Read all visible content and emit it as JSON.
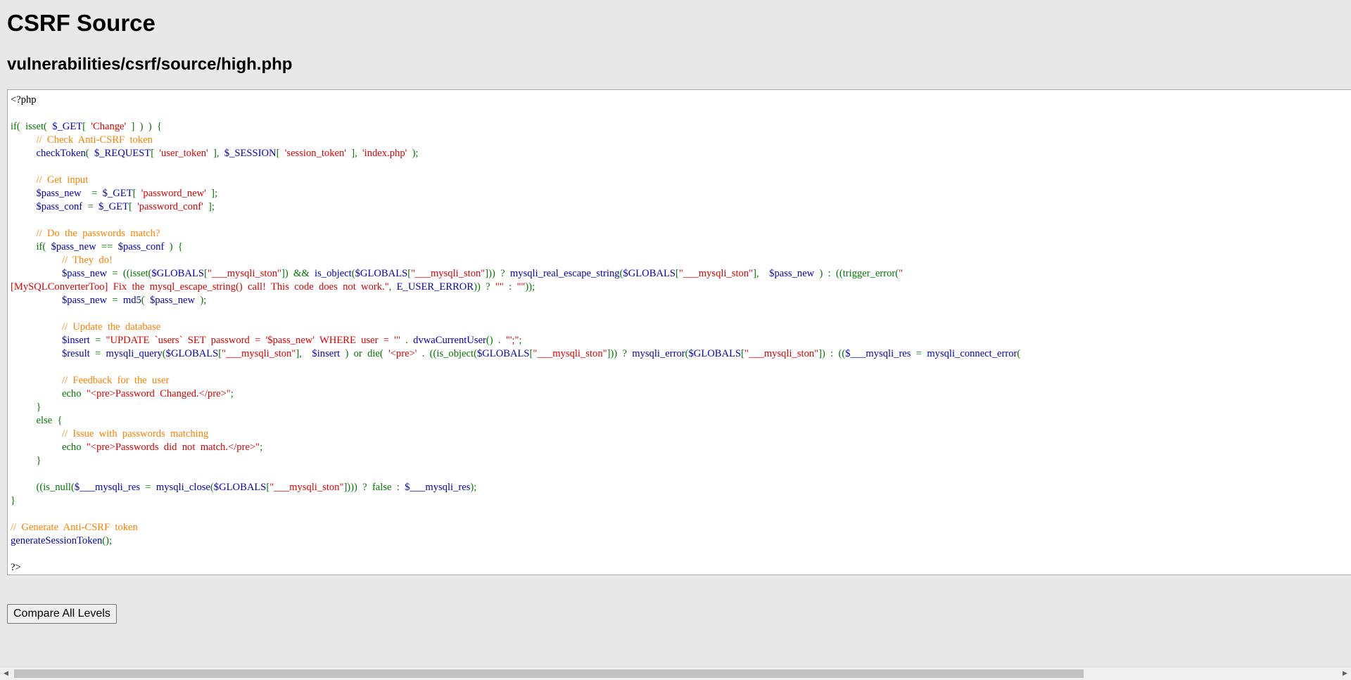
{
  "page": {
    "title": "CSRF Source",
    "path": "vulnerabilities/csrf/source/high.php"
  },
  "code_lines": [
    [
      {
        "c": "def",
        "t": "<?php"
      }
    ],
    [],
    [
      {
        "c": "kw",
        "t": "if(  isset(  "
      },
      {
        "c": "var",
        "t": "$_GET"
      },
      {
        "c": "kw",
        "t": "[  "
      },
      {
        "c": "str",
        "t": "'Change'"
      },
      {
        "c": "kw",
        "t": "  ]  )  )  {"
      }
    ],
    [
      {
        "c": "cmt",
        "t": "          //  Check  Anti-CSRF  token"
      }
    ],
    [
      {
        "c": "kw",
        "t": "          "
      },
      {
        "c": "var",
        "t": "checkToken"
      },
      {
        "c": "kw",
        "t": "(  "
      },
      {
        "c": "var",
        "t": "$_REQUEST"
      },
      {
        "c": "kw",
        "t": "[  "
      },
      {
        "c": "str",
        "t": "'user_token'"
      },
      {
        "c": "kw",
        "t": "  ],  "
      },
      {
        "c": "var",
        "t": "$_SESSION"
      },
      {
        "c": "kw",
        "t": "[  "
      },
      {
        "c": "str",
        "t": "'session_token'"
      },
      {
        "c": "kw",
        "t": "  ],  "
      },
      {
        "c": "str",
        "t": "'index.php'"
      },
      {
        "c": "kw",
        "t": "  );"
      }
    ],
    [],
    [
      {
        "c": "cmt",
        "t": "          //  Get  input"
      }
    ],
    [
      {
        "c": "kw",
        "t": "          "
      },
      {
        "c": "var",
        "t": "$pass_new"
      },
      {
        "c": "kw",
        "t": "    =  "
      },
      {
        "c": "var",
        "t": "$_GET"
      },
      {
        "c": "kw",
        "t": "[  "
      },
      {
        "c": "str",
        "t": "'password_new'"
      },
      {
        "c": "kw",
        "t": "  ];"
      }
    ],
    [
      {
        "c": "kw",
        "t": "          "
      },
      {
        "c": "var",
        "t": "$pass_conf"
      },
      {
        "c": "kw",
        "t": "  =  "
      },
      {
        "c": "var",
        "t": "$_GET"
      },
      {
        "c": "kw",
        "t": "[  "
      },
      {
        "c": "str",
        "t": "'password_conf'"
      },
      {
        "c": "kw",
        "t": "  ];"
      }
    ],
    [],
    [
      {
        "c": "cmt",
        "t": "          //  Do  the  passwords  match?"
      }
    ],
    [
      {
        "c": "kw",
        "t": "          if(  "
      },
      {
        "c": "var",
        "t": "$pass_new"
      },
      {
        "c": "kw",
        "t": "  ==  "
      },
      {
        "c": "var",
        "t": "$pass_conf"
      },
      {
        "c": "kw",
        "t": "  )  {"
      }
    ],
    [
      {
        "c": "cmt",
        "t": "                    //  They  do!"
      }
    ],
    [
      {
        "c": "kw",
        "t": "                    "
      },
      {
        "c": "var",
        "t": "$pass_new"
      },
      {
        "c": "kw",
        "t": "  =  ((isset("
      },
      {
        "c": "var",
        "t": "$GLOBALS"
      },
      {
        "c": "kw",
        "t": "["
      },
      {
        "c": "str",
        "t": "\"___mysqli_ston\""
      },
      {
        "c": "kw",
        "t": "])  &&  "
      },
      {
        "c": "var",
        "t": "is_object"
      },
      {
        "c": "kw",
        "t": "("
      },
      {
        "c": "var",
        "t": "$GLOBALS"
      },
      {
        "c": "kw",
        "t": "["
      },
      {
        "c": "str",
        "t": "\"___mysqli_ston\""
      },
      {
        "c": "kw",
        "t": "]))  ?  "
      },
      {
        "c": "var",
        "t": "mysqli_real_escape_string"
      },
      {
        "c": "kw",
        "t": "("
      },
      {
        "c": "var",
        "t": "$GLOBALS"
      },
      {
        "c": "kw",
        "t": "["
      },
      {
        "c": "str",
        "t": "\"___mysqli_ston\""
      },
      {
        "c": "kw",
        "t": "],    "
      },
      {
        "c": "var",
        "t": "$pass_new"
      },
      {
        "c": "kw",
        "t": "  )  :  ((trigger_error("
      },
      {
        "c": "str",
        "t": "\""
      }
    ],
    [
      {
        "c": "str",
        "t": "[MySQLConverterToo]  Fix  the  mysql_escape_string()  call!  This  code  does  not  work.\""
      },
      {
        "c": "kw",
        "t": ",  "
      },
      {
        "c": "var",
        "t": "E_USER_ERROR"
      },
      {
        "c": "kw",
        "t": "))  ?  "
      },
      {
        "c": "str",
        "t": "\"\""
      },
      {
        "c": "kw",
        "t": "  :  "
      },
      {
        "c": "str",
        "t": "\"\""
      },
      {
        "c": "kw",
        "t": "));"
      }
    ],
    [
      {
        "c": "kw",
        "t": "                    "
      },
      {
        "c": "var",
        "t": "$pass_new"
      },
      {
        "c": "kw",
        "t": "  =  "
      },
      {
        "c": "var",
        "t": "md5"
      },
      {
        "c": "kw",
        "t": "(  "
      },
      {
        "c": "var",
        "t": "$pass_new"
      },
      {
        "c": "kw",
        "t": "  );"
      }
    ],
    [],
    [
      {
        "c": "cmt",
        "t": "                    //  Update  the  database"
      }
    ],
    [
      {
        "c": "kw",
        "t": "                    "
      },
      {
        "c": "var",
        "t": "$insert"
      },
      {
        "c": "kw",
        "t": "  =  "
      },
      {
        "c": "str",
        "t": "\"UPDATE  `users`  SET  password  =  '$pass_new'  WHERE  user  =  '\""
      },
      {
        "c": "kw",
        "t": "  .  "
      },
      {
        "c": "var",
        "t": "dvwaCurrentUser"
      },
      {
        "c": "kw",
        "t": "()  .  "
      },
      {
        "c": "str",
        "t": "\"';\""
      },
      {
        "c": "kw",
        "t": ";"
      }
    ],
    [
      {
        "c": "kw",
        "t": "                    "
      },
      {
        "c": "var",
        "t": "$result"
      },
      {
        "c": "kw",
        "t": "  =  "
      },
      {
        "c": "var",
        "t": "mysqli_query"
      },
      {
        "c": "kw",
        "t": "("
      },
      {
        "c": "var",
        "t": "$GLOBALS"
      },
      {
        "c": "kw",
        "t": "["
      },
      {
        "c": "str",
        "t": "\"___mysqli_ston\""
      },
      {
        "c": "kw",
        "t": "],    "
      },
      {
        "c": "var",
        "t": "$insert"
      },
      {
        "c": "kw",
        "t": "  )  or  die(  "
      },
      {
        "c": "str",
        "t": "'<pre>'"
      },
      {
        "c": "kw",
        "t": "  .  ((is_object("
      },
      {
        "c": "var",
        "t": "$GLOBALS"
      },
      {
        "c": "kw",
        "t": "["
      },
      {
        "c": "str",
        "t": "\"___mysqli_ston\""
      },
      {
        "c": "kw",
        "t": "]))  ?  "
      },
      {
        "c": "var",
        "t": "mysqli_error"
      },
      {
        "c": "kw",
        "t": "("
      },
      {
        "c": "var",
        "t": "$GLOBALS"
      },
      {
        "c": "kw",
        "t": "["
      },
      {
        "c": "str",
        "t": "\"___mysqli_ston\""
      },
      {
        "c": "kw",
        "t": "])  :  (("
      },
      {
        "c": "var",
        "t": "$___mysqli_res"
      },
      {
        "c": "kw",
        "t": "  =  "
      },
      {
        "c": "var",
        "t": "mysqli_connect_error"
      },
      {
        "c": "kw",
        "t": "("
      }
    ],
    [],
    [
      {
        "c": "cmt",
        "t": "                    //  Feedback  for  the  user"
      }
    ],
    [
      {
        "c": "kw",
        "t": "                    echo  "
      },
      {
        "c": "str",
        "t": "\"<pre>Password  Changed.</pre>\""
      },
      {
        "c": "kw",
        "t": ";"
      }
    ],
    [
      {
        "c": "kw",
        "t": "          }"
      }
    ],
    [
      {
        "c": "kw",
        "t": "          else  {"
      }
    ],
    [
      {
        "c": "cmt",
        "t": "                    //  Issue  with  passwords  matching"
      }
    ],
    [
      {
        "c": "kw",
        "t": "                    echo  "
      },
      {
        "c": "str",
        "t": "\"<pre>Passwords  did  not  match.</pre>\""
      },
      {
        "c": "kw",
        "t": ";"
      }
    ],
    [
      {
        "c": "kw",
        "t": "          }"
      }
    ],
    [],
    [
      {
        "c": "kw",
        "t": "          ((is_null("
      },
      {
        "c": "var",
        "t": "$___mysqli_res"
      },
      {
        "c": "kw",
        "t": "  =  "
      },
      {
        "c": "var",
        "t": "mysqli_close"
      },
      {
        "c": "kw",
        "t": "("
      },
      {
        "c": "var",
        "t": "$GLOBALS"
      },
      {
        "c": "kw",
        "t": "["
      },
      {
        "c": "str",
        "t": "\"___mysqli_ston\""
      },
      {
        "c": "kw",
        "t": "])))  ?  false  :  "
      },
      {
        "c": "var",
        "t": "$___mysqli_res"
      },
      {
        "c": "kw",
        "t": ");"
      }
    ],
    [
      {
        "c": "kw",
        "t": "}"
      }
    ],
    [],
    [
      {
        "c": "cmt",
        "t": "//  Generate  Anti-CSRF  token"
      }
    ],
    [
      {
        "c": "var",
        "t": "generateSessionToken"
      },
      {
        "c": "kw",
        "t": "();"
      }
    ],
    [],
    [
      {
        "c": "def",
        "t": "?>"
      }
    ]
  ],
  "buttons": {
    "compare_label": "Compare All Levels"
  },
  "colors": {
    "background": "#e8e8e8",
    "code_background": "#ffffff",
    "keyword": "#007700",
    "string": "#dd0000",
    "variable": "#0000bb",
    "comment": "#ff8000",
    "default": "#000000"
  },
  "scrollbar": {
    "left_arrow_icon": "chevron-left-icon",
    "right_arrow_icon": "chevron-right-icon"
  }
}
